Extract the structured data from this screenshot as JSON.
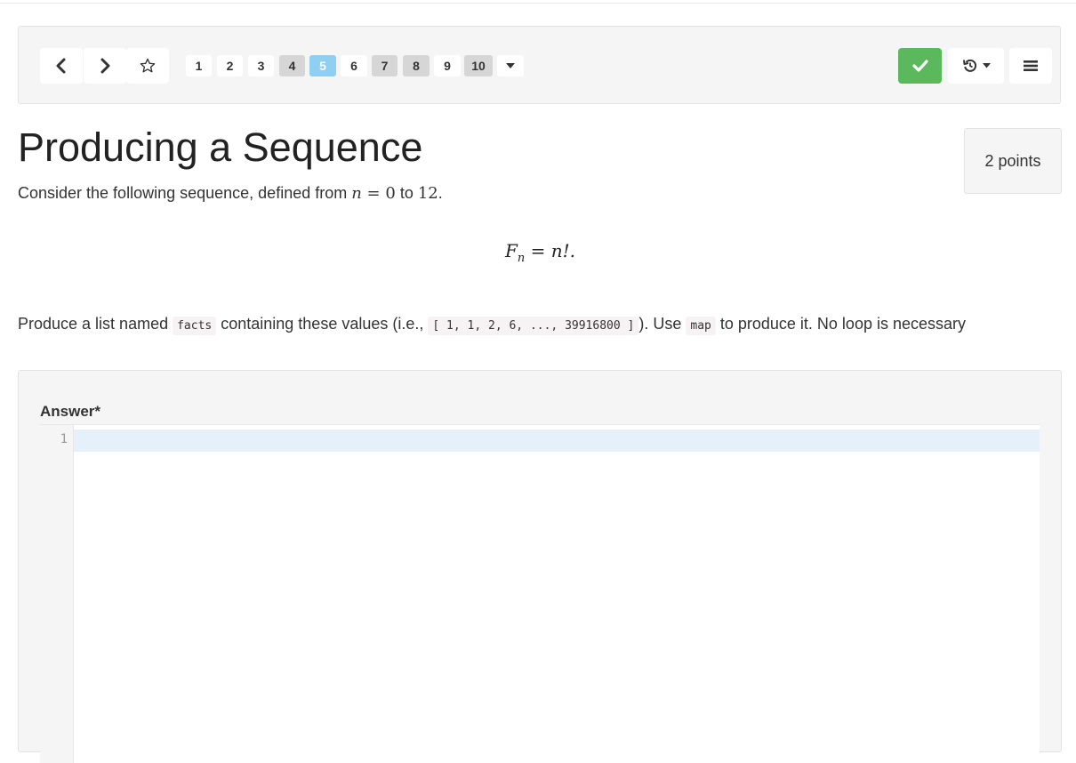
{
  "toolbar": {
    "pages": [
      "1",
      "2",
      "3",
      "4",
      "5",
      "6",
      "7",
      "8",
      "9",
      "10"
    ],
    "current_page": "5"
  },
  "question": {
    "title": "Producing a Sequence",
    "points": "2 points",
    "intro_prefix": "Consider the following sequence, defined from ",
    "intro_n": "n",
    "intro_eq": " = 0",
    "intro_to": " to ",
    "intro_12": "12",
    "intro_end": ".",
    "formula_F": "F",
    "formula_sub": "n",
    "formula_rest": " = n!.",
    "prompt_1": "Produce a list named ",
    "code_facts": "facts",
    "prompt_2": " containing these values (i.e., ",
    "code_list": "[ 1, 1, 2, 6, ..., 39916800 ]",
    "prompt_3": "). Use ",
    "code_map": "map",
    "prompt_4": " to produce it. No loop is necessary"
  },
  "answer": {
    "label": "Answer*",
    "line_number": "1",
    "value": ""
  },
  "colors": {
    "success": "#5cb85c",
    "active_page": "#8fd0f2"
  }
}
